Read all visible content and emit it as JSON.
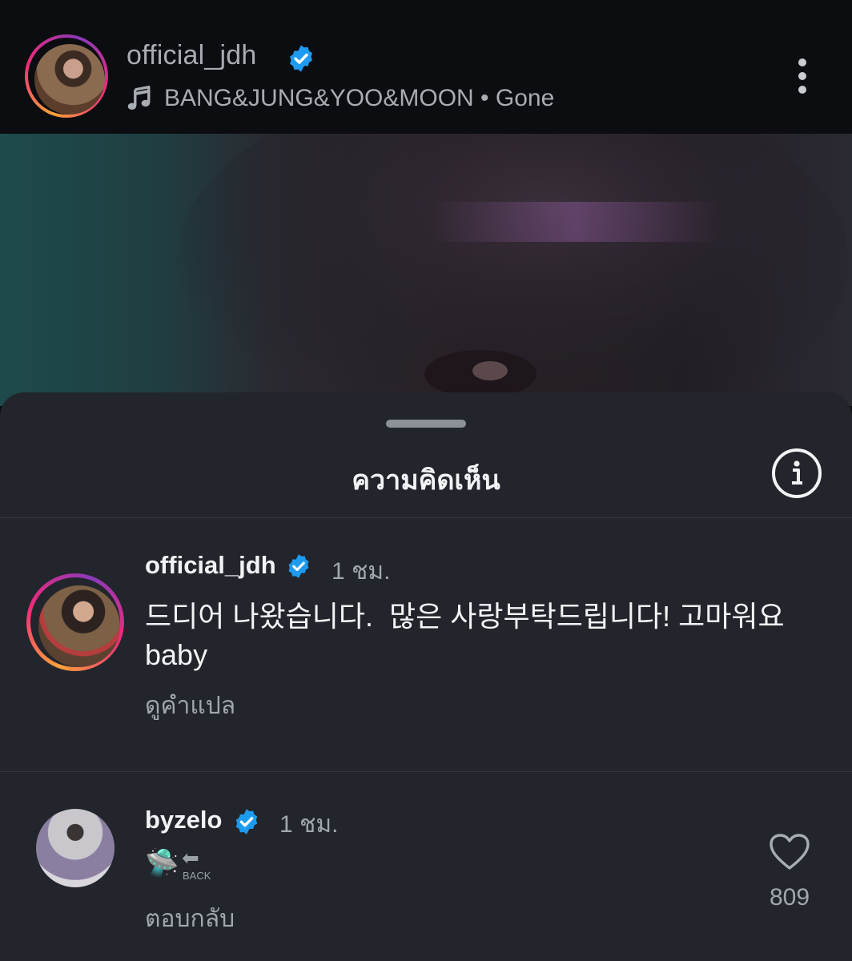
{
  "header": {
    "username": "official_jdh",
    "song": "BANG&JUNG&YOO&MOON • Gone"
  },
  "sheet": {
    "title": "ความคิดเห็น"
  },
  "comments": [
    {
      "username": "official_jdh",
      "verified": true,
      "time": "1 ชม.",
      "text": "드디어 나왔습니다.  많은 사랑부탁드립니다! 고마워요\nbaby",
      "translate_label": "ดูคำแปล"
    },
    {
      "username": "byzelo",
      "verified": true,
      "time": "1 ชม.",
      "emoji": "🛸",
      "emoji_arrow": "⬅",
      "emoji_label": "BACK",
      "reply_label": "ตอบกลับ",
      "like_count": "809"
    }
  ],
  "icons": {
    "music": "music-note-icon",
    "more": "more-vertical-icon",
    "info": "info-icon",
    "verified": "verified-badge-icon",
    "like": "heart-icon"
  },
  "colors": {
    "verified": "#1d9bf0",
    "sheet_background": "#22252b",
    "header_background": "#0c0d10"
  }
}
